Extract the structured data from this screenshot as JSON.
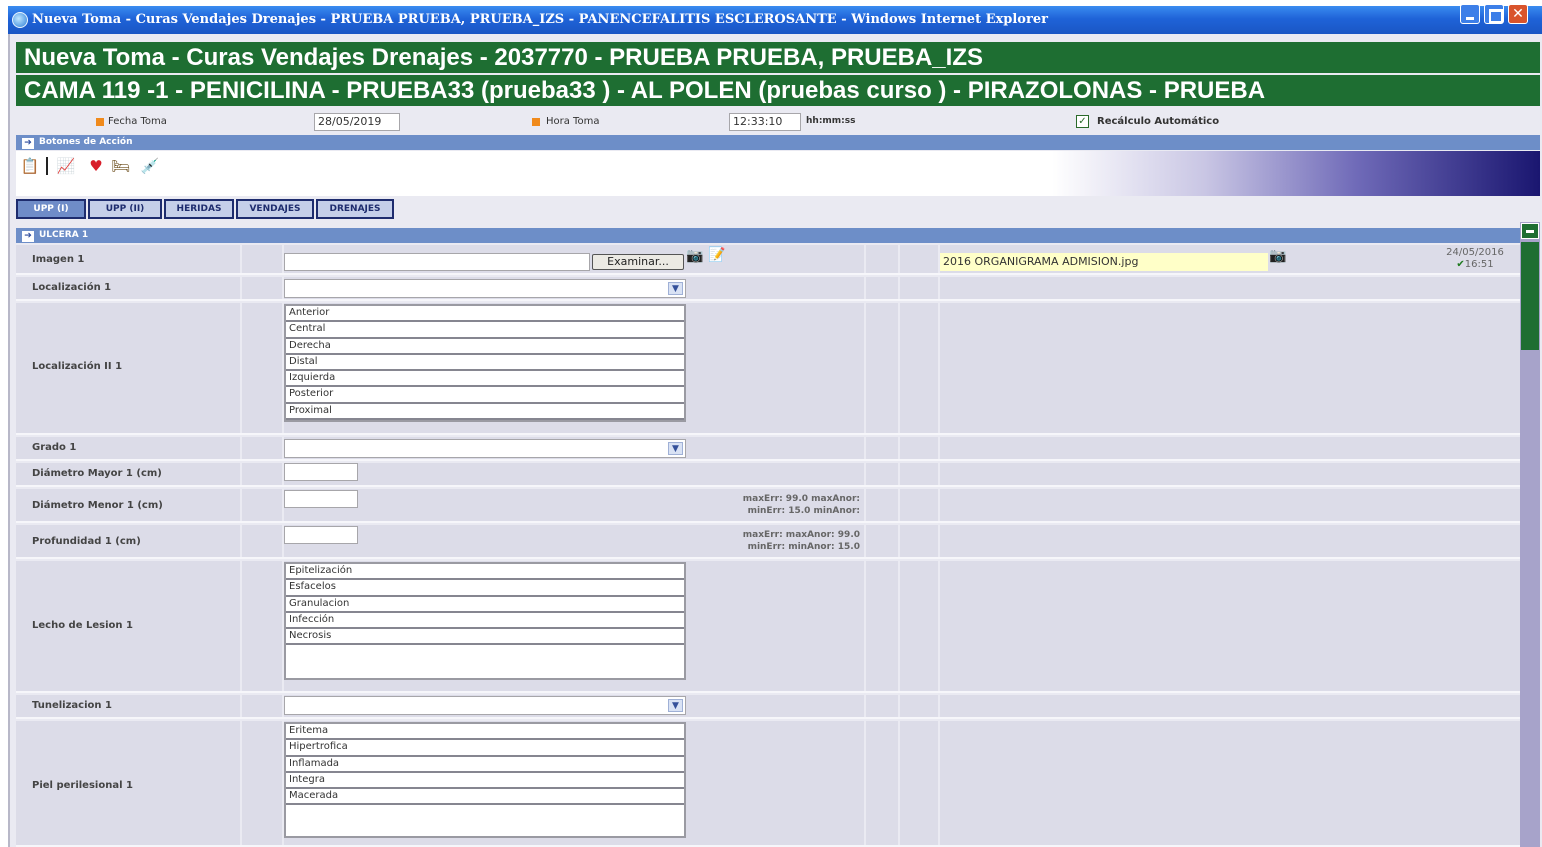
{
  "window": {
    "title": "Nueva Toma - Curas Vendajes Drenajes - PRUEBA PRUEBA, PRUEBA_IZS - PANENCEFALITIS ESCLEROSANTE  - Windows Internet Explorer"
  },
  "header": {
    "line1": "Nueva Toma - Curas Vendajes Drenajes - 2037770 - PRUEBA PRUEBA, PRUEBA_IZS",
    "line2": "CAMA 119 -1 - PENICILINA - PRUEBA33 (prueba33 ) - AL POLEN (pruebas curso ) - PIRAZOLONAS - PRUEBA"
  },
  "toma": {
    "fecha_label": "Fecha Toma",
    "fecha_value": "28/05/2019",
    "hora_label": "Hora Toma",
    "hora_value": "12:33:10",
    "hora_format": "hh:mm:ss",
    "recalculo_label": "Recálculo Automático",
    "recalculo_checked": true
  },
  "actions": {
    "section_title": "Botones de Acción",
    "icons": [
      "notes-icon",
      "chart-icon",
      "heart-icon",
      "bed-icon",
      "syringe-icon"
    ]
  },
  "tabs": [
    {
      "label": "UPP (I)",
      "active": true
    },
    {
      "label": "UPP (II)",
      "active": false
    },
    {
      "label": "HERIDAS",
      "active": false
    },
    {
      "label": "VENDAJES",
      "active": false
    },
    {
      "label": "DRENAJES",
      "active": false
    }
  ],
  "form": {
    "section_title": "ULCERA 1",
    "imagen": {
      "label": "Imagen 1",
      "browse_label": "Examinar...",
      "file_name": "2016 ORGANIGRAMA ADMISION.jpg",
      "date": "24/05/2016",
      "time": "16:51"
    },
    "localizacion": {
      "label": "Localización 1",
      "value": ""
    },
    "localizacion2": {
      "label": "Localización II 1",
      "options": [
        "Anterior",
        "Central",
        "Derecha",
        "Distal",
        "Izquierda",
        "Posterior",
        "Proximal"
      ]
    },
    "grado": {
      "label": "Grado 1",
      "value": ""
    },
    "diametro_mayor": {
      "label": "Diámetro Mayor 1 (cm)",
      "value": ""
    },
    "diametro_menor": {
      "label": "Diámetro Menor 1 (cm)",
      "value": "",
      "limits1": "maxErr: 99.0 maxAnor:",
      "limits2": "minErr: 15.0 minAnor:"
    },
    "profundidad": {
      "label": "Profundidad 1 (cm)",
      "value": "",
      "limits1": "maxErr: maxAnor: 99.0",
      "limits2": "minErr: minAnor: 15.0"
    },
    "lecho": {
      "label": "Lecho de Lesion 1",
      "options": [
        "Epitelización",
        "Esfacelos",
        "Granulacion",
        "Infección",
        "Necrosis"
      ]
    },
    "tunelizacion": {
      "label": "Tunelizacion 1",
      "value": ""
    },
    "piel": {
      "label": "Piel perilesional 1",
      "options": [
        "Eritema",
        "Hipertrofica",
        "Inflamada",
        "Integra",
        "Macerada"
      ]
    }
  },
  "colors": {
    "header_green": "#1e6e32",
    "section_blue": "#6d8ec8",
    "row_bg": "#dcdce8",
    "file_highlight": "#ffffc8"
  }
}
